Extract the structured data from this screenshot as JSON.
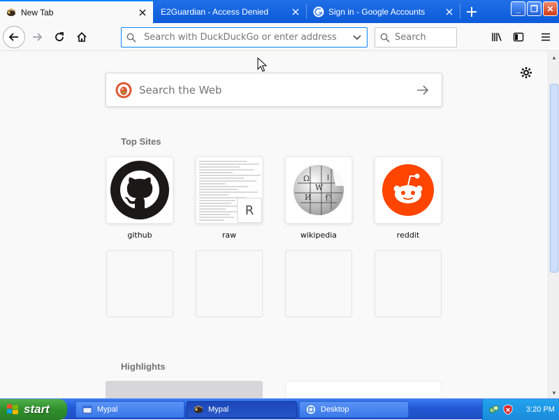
{
  "tabs": [
    {
      "title": "New Tab",
      "active": true
    },
    {
      "title": "E2Guardian - Access Denied",
      "active": false
    },
    {
      "title": "Sign in - Google Accounts",
      "active": false
    }
  ],
  "window_controls": {
    "minimize": "_",
    "restore": "❐",
    "close": "✕"
  },
  "navbar": {
    "url_placeholder": "Search with DuckDuckGo or enter address",
    "search_placeholder": "Search"
  },
  "newtab": {
    "search_placeholder": "Search the Web",
    "top_sites_title": "Top Sites",
    "highlights_title": "Highlights",
    "top_sites": [
      {
        "label": "github",
        "icon": "github-icon"
      },
      {
        "label": "raw",
        "icon": "raw-thumbnail",
        "badge": "R"
      },
      {
        "label": "wikipedia",
        "icon": "wikipedia-icon"
      },
      {
        "label": "reddit",
        "icon": "reddit-icon"
      }
    ]
  },
  "taskbar": {
    "start_label": "start",
    "items": [
      {
        "label": "Mypal",
        "state": "normal"
      },
      {
        "label": "Mypal",
        "state": "pressed"
      },
      {
        "label": "Desktop",
        "state": "normal"
      }
    ],
    "clock": "3:20 PM"
  },
  "colors": {
    "accent": "#0a84ff",
    "reddit": "#ff4500",
    "ddg": "#de5833",
    "taskbar": "#245edb",
    "start": "#3c9a36"
  }
}
